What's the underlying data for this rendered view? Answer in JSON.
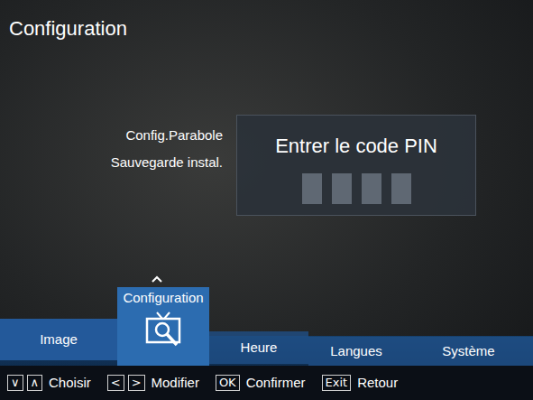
{
  "title": "Configuration",
  "submenu": {
    "items": [
      "Config.Parabole",
      "Sauvegarde instal."
    ]
  },
  "pin_dialog": {
    "title": "Entrer le code PIN",
    "digits": [
      {
        "filled": false
      },
      {
        "filled": false
      },
      {
        "filled": false
      },
      {
        "filled": false
      }
    ]
  },
  "menu": [
    {
      "label": "Image",
      "selected": false
    },
    {
      "label": "Configuration",
      "selected": true
    },
    {
      "label": "Heure",
      "selected": false
    },
    {
      "label": "Langues",
      "selected": false
    },
    {
      "label": "Système",
      "selected": false
    }
  ],
  "help_bar": [
    {
      "keys": [
        "∨",
        "∧"
      ],
      "label": "Choisir"
    },
    {
      "keys": [
        "<",
        ">"
      ],
      "label": "Modifier"
    },
    {
      "keys": [
        "OK"
      ],
      "label": "Confirmer"
    },
    {
      "keys": [
        "Exit"
      ],
      "label": "Retour"
    }
  ]
}
